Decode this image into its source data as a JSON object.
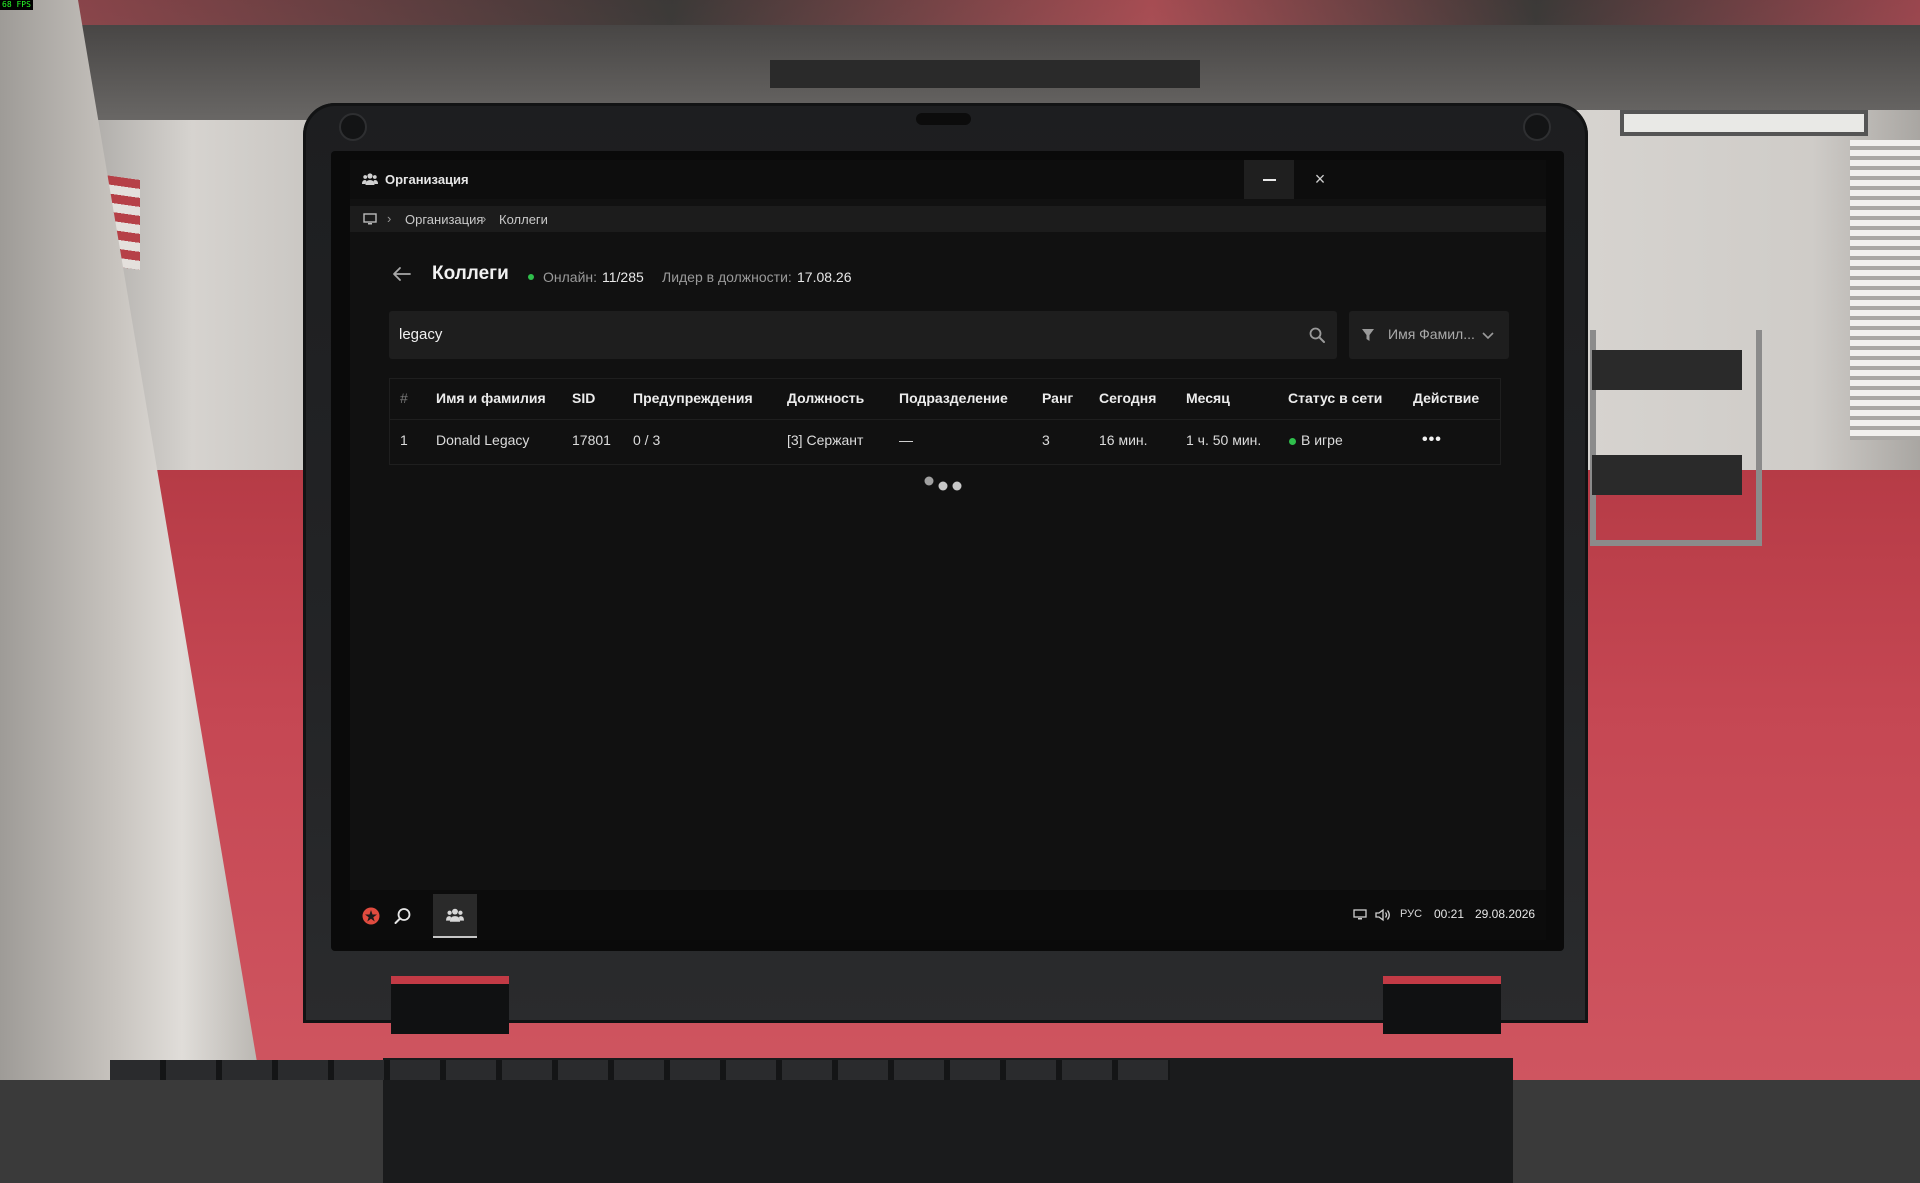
{
  "hud": {
    "fps": "68 FPS"
  },
  "window": {
    "title": "Организация",
    "icon": "people-icon",
    "close_glyph": "×"
  },
  "breadcrumb": {
    "items": [
      "Организация",
      "Коллеги"
    ],
    "separator": "›"
  },
  "header": {
    "title": "Коллеги",
    "online_label": "Онлайн:",
    "online_value": "11/285",
    "leader_label": "Лидер в должности:",
    "leader_value": "17.08.26"
  },
  "search": {
    "value": "legacy"
  },
  "filter": {
    "label": "Имя Фамил..."
  },
  "table": {
    "columns": [
      "#",
      "Имя и фамилия",
      "SID",
      "Предупреждения",
      "Должность",
      "Подразделение",
      "Ранг",
      "Сегодня",
      "Месяц",
      "Статус в сети",
      "Действие"
    ],
    "rows": [
      {
        "num": "1",
        "name": "Donald Legacy",
        "sid": "17801",
        "warnings": "0 / 3",
        "position": "[3] Сержант",
        "division": "—",
        "rank": "3",
        "today": "16 мин.",
        "month": "1 ч. 50 мин.",
        "status": "В игре",
        "action": "•••"
      }
    ]
  },
  "taskbar": {
    "lang": "РУС",
    "time": "00:21",
    "date": "29.08.2026"
  },
  "colors": {
    "online": "#2fbf4c",
    "accent_red": "#e04b3f",
    "panel": "#111111"
  }
}
